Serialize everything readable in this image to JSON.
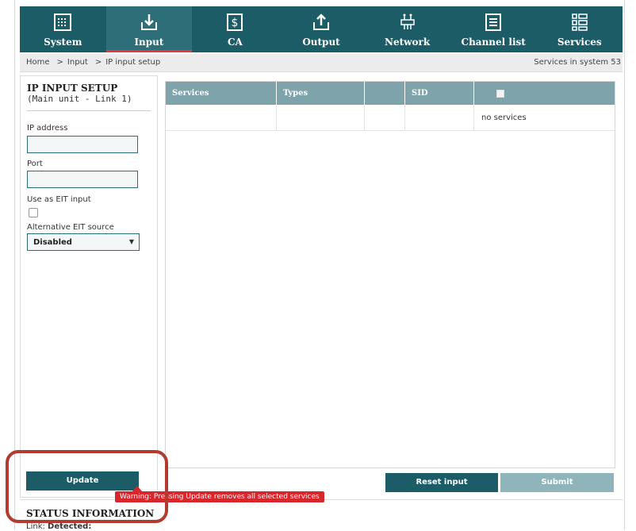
{
  "nav": {
    "items": [
      {
        "label": "System",
        "icon": "system-icon"
      },
      {
        "label": "Input",
        "icon": "input-icon",
        "active": true
      },
      {
        "label": "CA",
        "icon": "ca-icon"
      },
      {
        "label": "Output",
        "icon": "output-icon"
      },
      {
        "label": "Network",
        "icon": "network-icon"
      },
      {
        "label": "Channel list",
        "icon": "channel-list-icon"
      },
      {
        "label": "Services",
        "icon": "services-icon"
      }
    ]
  },
  "breadcrumb": {
    "items": [
      "Home",
      "Input",
      "IP input setup"
    ],
    "separator": ">"
  },
  "services_count": "Services in system 53",
  "panel": {
    "title": "IP INPUT SETUP",
    "subtitle": "(Main unit - Link 1)",
    "ip_label": "IP address",
    "ip_value": "",
    "port_label": "Port",
    "port_value": "",
    "eit_label": "Use as EIT input",
    "alt_eit_label": "Alternative EIT source",
    "alt_eit_value": "Disabled"
  },
  "table": {
    "headers": [
      "Services",
      "Types",
      "",
      "SID",
      ""
    ],
    "empty_text": "no services"
  },
  "buttons": {
    "update": "Update",
    "reset": "Reset input",
    "submit": "Submit"
  },
  "warning": "Warning: Pressing Update removes all selected services",
  "status": {
    "title": "STATUS INFORMATION",
    "link_label": "Link:",
    "link_value": "Detected:"
  },
  "colors": {
    "nav_bg": "#1c5c67",
    "accent": "#e23a3a",
    "table_header": "#7ea3aa",
    "submit_disabled": "#8fb5bb",
    "warning_bg": "#d8262d",
    "highlight": "#b23a2f"
  }
}
